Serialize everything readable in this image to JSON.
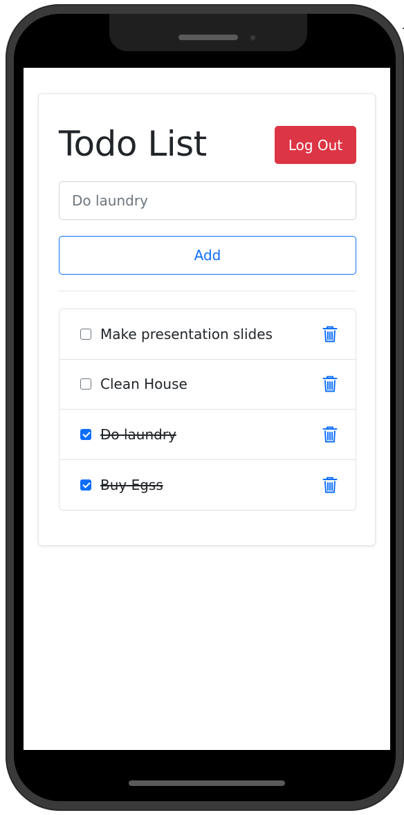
{
  "app": {
    "title": "Todo List",
    "logout_label": "Log Out"
  },
  "form": {
    "input_value": "",
    "input_placeholder": "Do laundry",
    "add_label": "Add"
  },
  "todos": [
    {
      "text": "Make presentation slides",
      "done": false
    },
    {
      "text": "Clean House",
      "done": false
    },
    {
      "text": "Do laundry",
      "done": true
    },
    {
      "text": "Buy Egss",
      "done": true
    }
  ],
  "colors": {
    "danger": "#dc3545",
    "primary": "#0d6efd",
    "text": "#212529",
    "border": "#dee2e6"
  },
  "icons": {
    "delete": "trash-icon"
  }
}
